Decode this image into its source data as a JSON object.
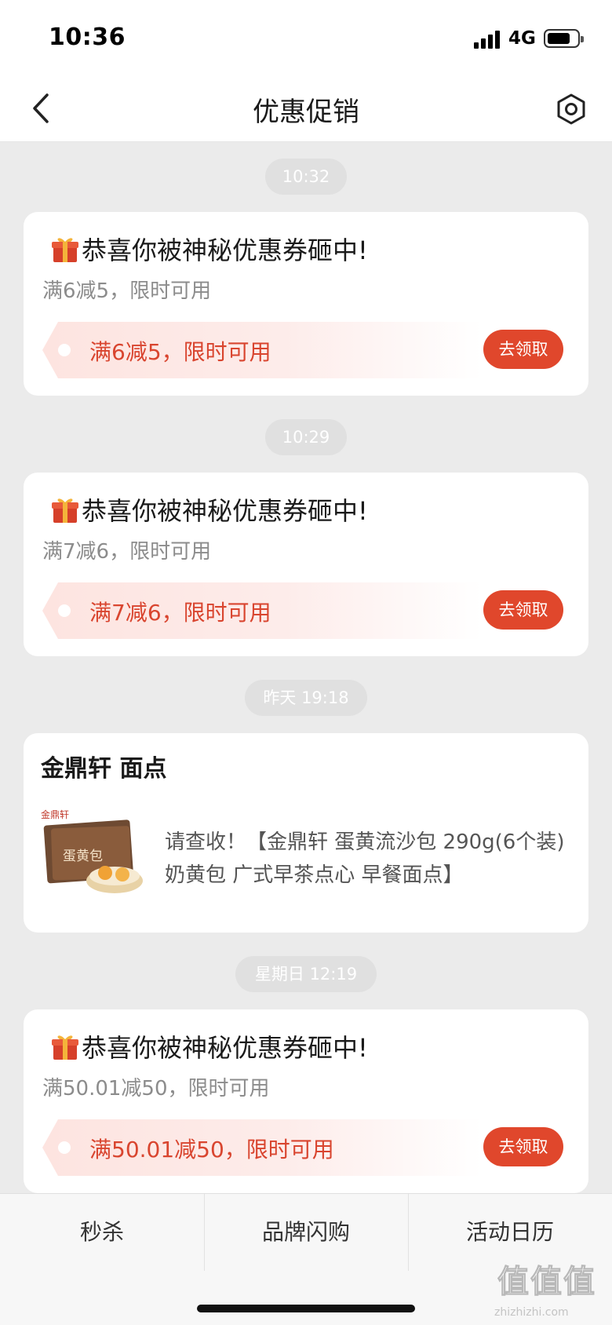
{
  "status_bar": {
    "time": "10:36",
    "network": "4G"
  },
  "nav": {
    "title": "优惠促销"
  },
  "messages": [
    {
      "time": "10:32",
      "title": "恭喜你被神秘优惠券砸中!",
      "subtitle": "满6减5，限时可用",
      "coupon": "满6减5，限时可用",
      "button": "去领取"
    },
    {
      "time": "10:29",
      "title": "恭喜你被神秘优惠券砸中!",
      "subtitle": "满7减6，限时可用",
      "coupon": "满7减6，限时可用",
      "button": "去领取"
    },
    {
      "time": "昨天 19:18",
      "store": "金鼎轩 面点",
      "desc": "请查收！【金鼎轩 蛋黄流沙包 290g(6个装) 奶黄包 广式早茶点心 早餐面点】",
      "img_brand": "金鼎轩",
      "img_text": "蛋黄包"
    },
    {
      "time": "星期日 12:19",
      "title": "恭喜你被神秘优惠券砸中!",
      "subtitle": "满50.01减50，限时可用",
      "coupon": "满50.01减50，限时可用",
      "button": "去领取"
    }
  ],
  "tabs": [
    "秒杀",
    "品牌闪购",
    "活动日历"
  ],
  "watermark": {
    "logo": "值值值",
    "url": "zhizhizhi.com"
  },
  "colors": {
    "accent": "#e0472c",
    "coupon_text": "#d9452f",
    "background": "#ebebeb"
  }
}
